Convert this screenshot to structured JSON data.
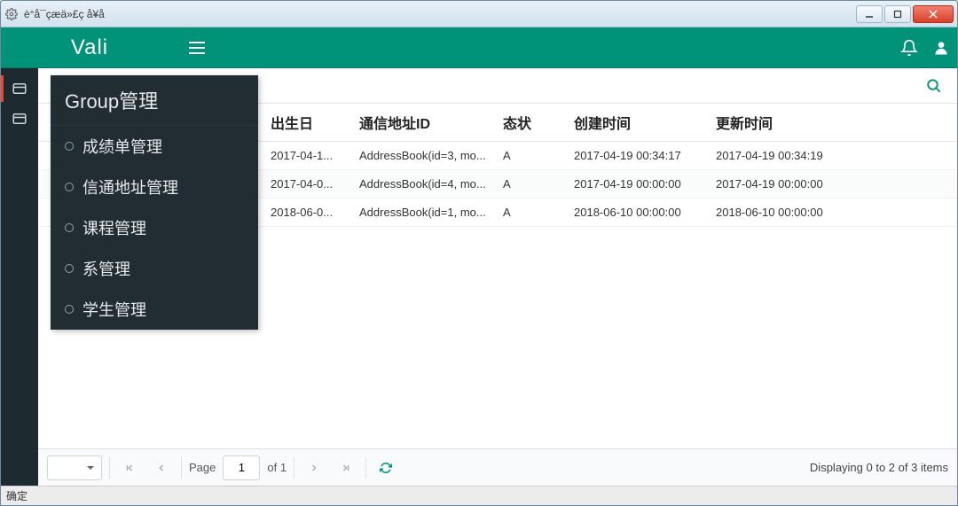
{
  "window": {
    "title": "è°å¯çæä»£ç å¥å"
  },
  "header": {
    "brand": "Vali"
  },
  "sidebar": {
    "tooltip": "Group管理",
    "menu_title": "Group管理",
    "menu_items": [
      {
        "label": "成绩单管理"
      },
      {
        "label": "信通地址管理"
      },
      {
        "label": "课程管理"
      },
      {
        "label": "系管理"
      },
      {
        "label": "学生管理"
      }
    ]
  },
  "table": {
    "columns": {
      "birth": "出生日",
      "addr": "通信地址ID",
      "state": "态状",
      "created": "创建时间",
      "updated": "更新时间"
    },
    "rows": [
      {
        "birth": "2017-04-1...",
        "addr": "AddressBook(id=3, mo...",
        "state": "A",
        "created": "2017-04-19 00:34:17",
        "updated": "2017-04-19 00:34:19"
      },
      {
        "birth": "2017-04-0...",
        "addr": "AddressBook(id=4, mo...",
        "state": "A",
        "created": "2017-04-19 00:00:00",
        "updated": "2017-04-19 00:00:00"
      },
      {
        "birth": "2018-06-0...",
        "addr": "AddressBook(id=1, mo...",
        "state": "A",
        "created": "2018-06-10 00:00:00",
        "updated": "2018-06-10 00:00:00"
      }
    ]
  },
  "pager": {
    "page_label": "Page",
    "page_value": "1",
    "of_label": "of 1",
    "display": "Displaying 0 to 2 of 3 items"
  },
  "statusbar": {
    "text": "确定"
  }
}
